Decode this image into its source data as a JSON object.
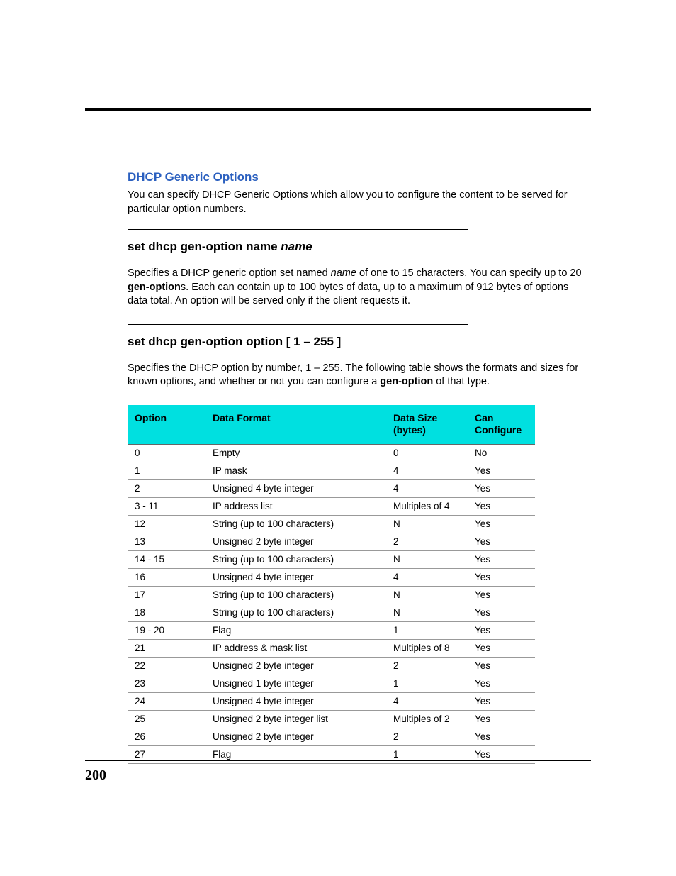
{
  "section": {
    "title": "DHCP Generic Options",
    "description": "You can specify DHCP Generic Options which allow you to configure the content to be served for particular option numbers."
  },
  "cmd1": {
    "heading_prefix": "set dhcp gen-option name ",
    "heading_ital": "name",
    "desc_1": "Specifies a DHCP generic option set named ",
    "desc_ital": "name",
    "desc_2": " of one to 15 characters. You can specify up to 20 ",
    "desc_bold": "gen-option",
    "desc_3": "s. Each can contain up to 100 bytes of data, up to a maximum of 912 bytes of options data total. An option will be served only if the client requests it."
  },
  "cmd2": {
    "heading": "set dhcp gen-option option [ 1 – 255 ]",
    "desc_1": "Specifies the DHCP option by number, 1 – 255. The following table shows the formats and sizes for known options, and whether or not you can configure a ",
    "desc_bold": "gen-option",
    "desc_2": " of that type."
  },
  "table": {
    "headers": {
      "option": "Option",
      "format": "Data Format",
      "size_l1": "Data Size",
      "size_l2": "(bytes)",
      "conf_l1": "Can",
      "conf_l2": "Configure"
    },
    "rows": [
      {
        "option": "0",
        "format": "Empty",
        "size": "0",
        "conf": "No"
      },
      {
        "option": "1",
        "format": "IP mask",
        "size": "4",
        "conf": "Yes"
      },
      {
        "option": "2",
        "format": "Unsigned 4 byte integer",
        "size": "4",
        "conf": "Yes"
      },
      {
        "option": "3 - 11",
        "format": "IP address list",
        "size": "Multiples of 4",
        "conf": "Yes"
      },
      {
        "option": "12",
        "format": "String (up to 100 characters)",
        "size": "N",
        "conf": "Yes"
      },
      {
        "option": "13",
        "format": "Unsigned 2 byte integer",
        "size": "2",
        "conf": "Yes"
      },
      {
        "option": "14 - 15",
        "format": "String (up to 100 characters)",
        "size": "N",
        "conf": "Yes"
      },
      {
        "option": "16",
        "format": "Unsigned 4 byte integer",
        "size": "4",
        "conf": "Yes"
      },
      {
        "option": "17",
        "format": "String (up to 100 characters)",
        "size": "N",
        "conf": "Yes"
      },
      {
        "option": "18",
        "format": "String (up to 100 characters)",
        "size": "N",
        "conf": "Yes"
      },
      {
        "option": "19 - 20",
        "format": "Flag",
        "size": "1",
        "conf": "Yes"
      },
      {
        "option": "21",
        "format": "IP address & mask list",
        "size": "Multiples of 8",
        "conf": "Yes"
      },
      {
        "option": "22",
        "format": "Unsigned 2 byte integer",
        "size": "2",
        "conf": "Yes"
      },
      {
        "option": "23",
        "format": "Unsigned 1 byte integer",
        "size": "1",
        "conf": "Yes"
      },
      {
        "option": "24",
        "format": "Unsigned 4 byte integer",
        "size": "4",
        "conf": "Yes"
      },
      {
        "option": "25",
        "format": "Unsigned 2 byte integer list",
        "size": "Multiples of 2",
        "conf": "Yes"
      },
      {
        "option": "26",
        "format": "Unsigned 2 byte integer",
        "size": "2",
        "conf": "Yes"
      },
      {
        "option": "27",
        "format": "Flag",
        "size": "1",
        "conf": "Yes"
      }
    ]
  },
  "page_number": "200"
}
